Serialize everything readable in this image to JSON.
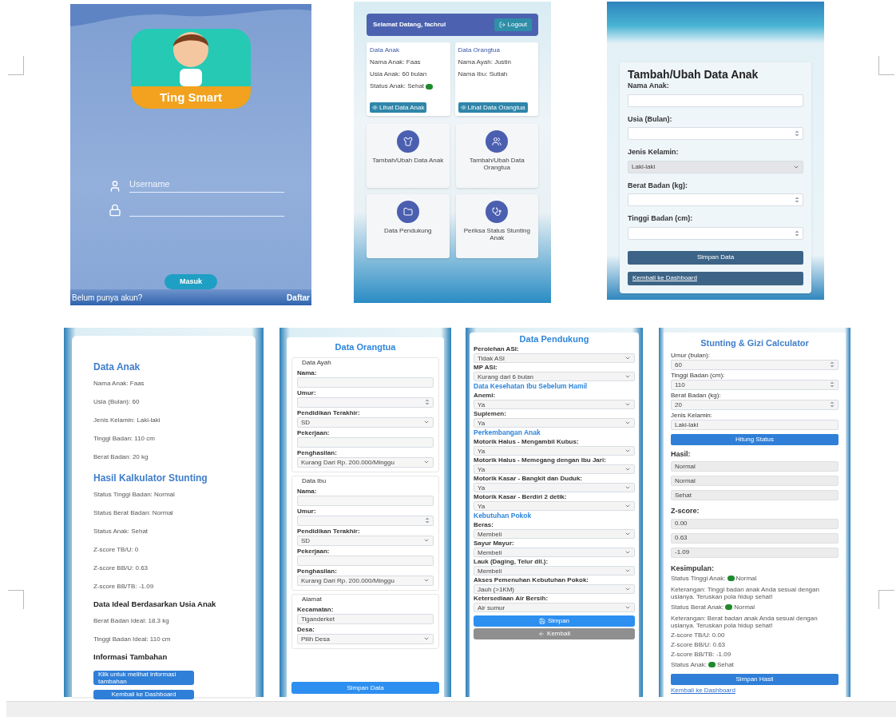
{
  "login_screen": {
    "app_name": "Ting Smart",
    "username_placeholder": "Username",
    "login_button": "Masuk",
    "signup_prompt": "Belum punya akun?",
    "signup_link": "Daftar"
  },
  "dashboard_screen": {
    "greeting": "Selamat Datang, fachrul",
    "logout_button": "Logout",
    "cards": [
      {
        "title": "Data Anak",
        "lines": [
          {
            "kind": "text",
            "text": "Nama Anak: Faas"
          },
          {
            "kind": "text",
            "text": "Usia Anak: 60 bulan"
          },
          {
            "kind": "status",
            "text": "Status Anak: Sehat"
          }
        ],
        "button": "Lihat Data Anak"
      },
      {
        "title": "Data Orangtua",
        "lines": [
          {
            "kind": "text",
            "text": "Nama Ayah: Justin"
          },
          {
            "kind": "text",
            "text": "Nama Ibu: Sutiah"
          }
        ],
        "button": "Lihat Data Orangtua"
      }
    ],
    "menu": [
      {
        "label": "Tambah/Ubah Data Anak"
      },
      {
        "label": "Tambah/Ubah Data Orangtua"
      },
      {
        "label": "Data Pendukung"
      },
      {
        "label": "Periksa Status Stunting Anak"
      }
    ]
  },
  "child_form_screen": {
    "title": "Tambah/Ubah Data Anak",
    "fields": [
      {
        "label": "Nama Anak:",
        "kind": "text"
      },
      {
        "label": "Usia (Bulan):",
        "kind": "number"
      },
      {
        "label": "Jenis Kelamin:",
        "kind": "select",
        "value": "Laki-laki"
      },
      {
        "label": "Berat Badan (kg):",
        "kind": "number"
      },
      {
        "label": "Tinggi Badan (cm):",
        "kind": "number"
      }
    ],
    "save_button": "Simpan Data",
    "back_button": "Kembali ke Dashboard"
  },
  "child_detail_screen": {
    "items": [
      {
        "kind": "title",
        "text": "Data Anak"
      },
      {
        "kind": "line",
        "text": "Nama Anak: Faas"
      },
      {
        "kind": "line",
        "text": "Usia (Bulan): 60"
      },
      {
        "kind": "line",
        "text": "Jenis Kelamin: Laki-laki"
      },
      {
        "kind": "line",
        "text": "Tinggi Badan: 110 cm"
      },
      {
        "kind": "line",
        "text": "Berat Badan: 20 kg"
      },
      {
        "kind": "title",
        "text": "Hasil Kalkulator Stunting"
      },
      {
        "kind": "line",
        "text": "Status Tinggi Badan: Normal"
      },
      {
        "kind": "line",
        "text": "Status Berat Badan: Normal"
      },
      {
        "kind": "line",
        "text": "Status Anak: Sehat"
      },
      {
        "kind": "line",
        "text": "Z-score TB/U: 0"
      },
      {
        "kind": "line",
        "text": "Z-score BB/U: 0.63"
      },
      {
        "kind": "line",
        "text": "Z-score BB/TB: -1.09"
      },
      {
        "kind": "subtitle",
        "text": "Data Ideal Berdasarkan Usia Anak"
      },
      {
        "kind": "line",
        "text": "Berat Badan Ideal: 18.3 kg"
      },
      {
        "kind": "line",
        "text": "Tinggi Badan Ideal: 110 cm"
      },
      {
        "kind": "subtitle",
        "text": "Informasi Tambahan"
      }
    ],
    "info_button": "Klik untuk melihat informasi tambahan",
    "back_button": "Kembali ke Dashboard"
  },
  "parent_form_screen": {
    "title": "Data Orangtua",
    "groups": [
      {
        "legend": "Data Ayah",
        "fields": [
          {
            "label": "Nama:",
            "kind": "text"
          },
          {
            "label": "Umur:",
            "kind": "number"
          },
          {
            "label": "Pendidikan Terakhir:",
            "kind": "select",
            "value": "SD"
          },
          {
            "label": "Pekerjaan:",
            "kind": "text"
          },
          {
            "label": "Penghasilan:",
            "kind": "select",
            "value": "Kurang Dari Rp. 200.000/Minggu"
          }
        ]
      },
      {
        "legend": "Data Ibu",
        "fields": [
          {
            "label": "Nama:",
            "kind": "text"
          },
          {
            "label": "Umur:",
            "kind": "number"
          },
          {
            "label": "Pendidikan Terakhir:",
            "kind": "select",
            "value": "SD"
          },
          {
            "label": "Pekerjaan:",
            "kind": "text"
          },
          {
            "label": "Penghasilan:",
            "kind": "select",
            "value": "Kurang Dari Rp. 200.000/Minggu"
          }
        ]
      },
      {
        "legend": "Alamat",
        "fields": [
          {
            "label": "Kecamatan:",
            "kind": "text",
            "value": "Tiganderket"
          },
          {
            "label": "Desa:",
            "kind": "select",
            "value": "Pilih Desa"
          }
        ]
      }
    ],
    "save_button": "Simpan Data"
  },
  "support_screen": {
    "title": "Data Pendukung",
    "items": [
      {
        "kind": "field",
        "label": "Perolehan ASI:",
        "value": "Tidak ASI"
      },
      {
        "kind": "field",
        "label": "MP ASI:",
        "value": "Kurang dari 6 bulan"
      },
      {
        "kind": "heading",
        "text": "Data Kesehatan Ibu Sebelum Hamil"
      },
      {
        "kind": "field",
        "label": "Anemi:",
        "value": "Ya"
      },
      {
        "kind": "field",
        "label": "Suplemen:",
        "value": "Ya"
      },
      {
        "kind": "heading",
        "text": "Perkembangan Anak"
      },
      {
        "kind": "field",
        "label": "Motorik Halus - Mengambil Kubus:",
        "value": "Ya"
      },
      {
        "kind": "field",
        "label": "Motorik Halus - Memegang dengan Ibu Jari:",
        "value": "Ya"
      },
      {
        "kind": "field",
        "label": "Motorik Kasar - Bangkit dan Duduk:",
        "value": "Ya"
      },
      {
        "kind": "field",
        "label": "Motorik Kasar - Berdiri 2 detik:",
        "value": "Ya"
      },
      {
        "kind": "heading",
        "text": "Kebutuhan Pokok"
      },
      {
        "kind": "field",
        "label": "Beras:",
        "value": "Membeli"
      },
      {
        "kind": "field",
        "label": "Sayur Mayur:",
        "value": "Membeli"
      },
      {
        "kind": "field",
        "label": "Lauk (Daging, Telur dll.):",
        "value": "Membeli"
      },
      {
        "kind": "field",
        "label": "Akses Pemenuhan Kebutuhan Pokok:",
        "value": "Jauh (>1KM)"
      },
      {
        "kind": "field",
        "label": "Ketersediaan Air Bersih:",
        "value": "Air sumur"
      }
    ],
    "save_button": "Simpan",
    "back_button": "Kembali"
  },
  "calculator_screen": {
    "title": "Stunting & Gizi Calculator",
    "inputs": [
      {
        "label": "Umur (bulan):",
        "kind": "number",
        "value": "60"
      },
      {
        "label": "Tinggi Badan (cm):",
        "kind": "number",
        "value": "110"
      },
      {
        "label": "Berat Badan (kg):",
        "kind": "number",
        "value": "20"
      },
      {
        "label": "Jenis Kelamin:",
        "kind": "text",
        "value": "Laki-laki"
      }
    ],
    "calculate_button": "Hitung Status",
    "result_label": "Hasil:",
    "results": [
      "Normal",
      "Normal",
      "Sehat"
    ],
    "zscore_label": "Z-score:",
    "zscores": [
      "0.00",
      "0.63",
      "-1.09"
    ],
    "conclusion_label": "Kesimpulan:",
    "conclusion": [
      {
        "kind": "status",
        "text": "Status Tinggi Anak:",
        "value": "Normal"
      },
      {
        "kind": "note",
        "text": "Keterangan: Tinggi badan anak Anda sesuai dengan usianya. Teruskan pola hidup sehat!"
      },
      {
        "kind": "status",
        "text": "Status Berat Anak:",
        "value": "Normal"
      },
      {
        "kind": "note",
        "text": "Keterangan: Berat badan anak Anda sesuai dengan usianya. Teruskan pola hidup sehat!"
      },
      {
        "kind": "note",
        "text": "Z-score TB/U: 0.00"
      },
      {
        "kind": "note",
        "text": "Z-score BB/U: 0.63"
      },
      {
        "kind": "note",
        "text": "Z-score BB/TB: -1.09"
      },
      {
        "kind": "status",
        "text": "Status Anak:",
        "value": "Sehat"
      }
    ],
    "save_button": "Simpan Hasil",
    "back_link": "Kembali ke Dashboard"
  }
}
